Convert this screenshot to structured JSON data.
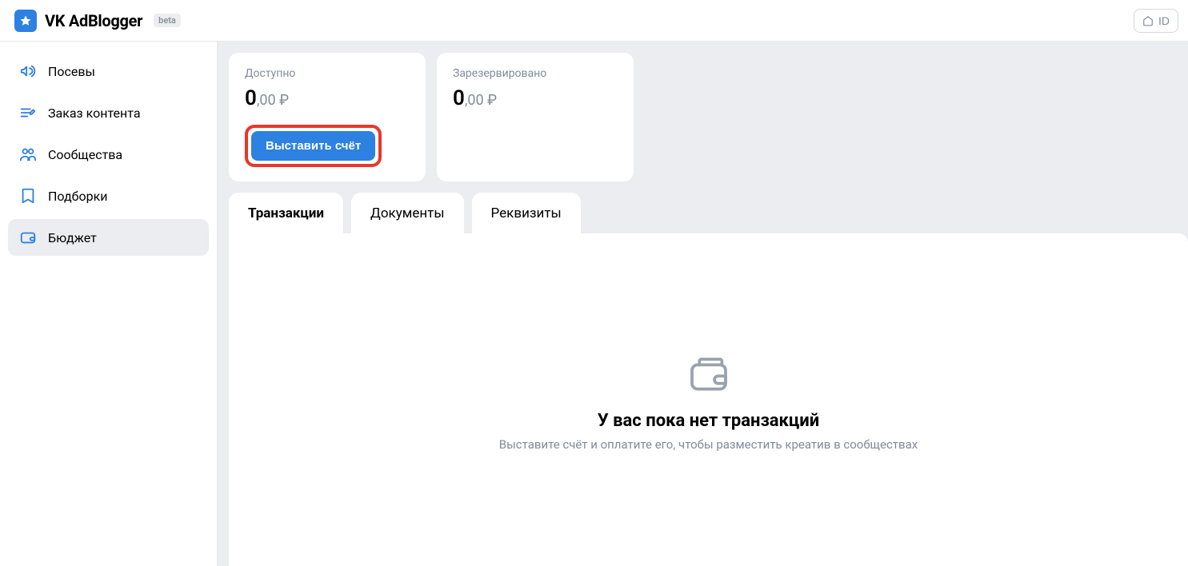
{
  "header": {
    "title": "VK AdBlogger",
    "badge": "beta",
    "id_label": "ID"
  },
  "sidebar": {
    "items": [
      {
        "label": "Посевы"
      },
      {
        "label": "Заказ контента"
      },
      {
        "label": "Сообщества"
      },
      {
        "label": "Подборки"
      },
      {
        "label": "Бюджет"
      }
    ]
  },
  "cards": {
    "available": {
      "label": "Доступно",
      "int": "0",
      "dec": ",00 ₽"
    },
    "reserved": {
      "label": "Зарезервировано",
      "int": "0",
      "dec": ",00 ₽"
    },
    "invoice_button": "Выставить счёт"
  },
  "tabs": [
    {
      "label": "Транзакции"
    },
    {
      "label": "Документы"
    },
    {
      "label": "Реквизиты"
    }
  ],
  "empty": {
    "title": "У вас пока нет транзакций",
    "subtitle": "Выставите счёт и оплатите его, чтобы разместить креатив в сообществах"
  }
}
